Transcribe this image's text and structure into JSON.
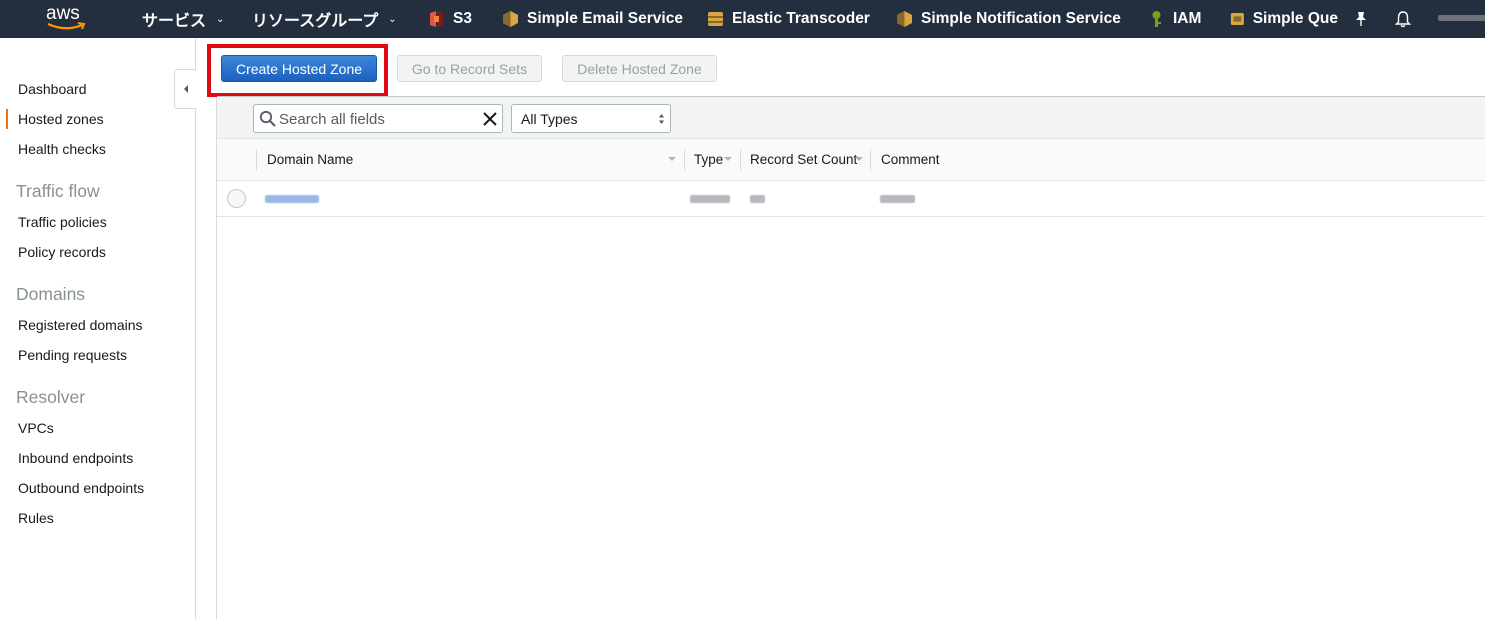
{
  "topnav": {
    "logo_text": "aws",
    "services_menu": "サービス",
    "resource_groups_menu": "リソースグループ",
    "services": [
      {
        "label": "S3",
        "icon": "s3-icon"
      },
      {
        "label": "Simple Email Service",
        "icon": "ses-icon"
      },
      {
        "label": "Elastic Transcoder",
        "icon": "transcoder-icon"
      },
      {
        "label": "Simple Notification Service",
        "icon": "sns-icon"
      },
      {
        "label": "IAM",
        "icon": "iam-icon"
      },
      {
        "label": "Simple Que",
        "icon": "sqs-icon"
      }
    ],
    "colors": {
      "bg": "#232f3e",
      "accent": "#ec7211"
    }
  },
  "sidebar": {
    "items": [
      {
        "label": "Dashboard"
      },
      {
        "label": "Hosted zones",
        "active": true
      }
    ],
    "health_checks": "Health checks",
    "sections": [
      {
        "heading": "Traffic flow",
        "items": [
          "Traffic policies",
          "Policy records"
        ]
      },
      {
        "heading": "Domains",
        "items": [
          "Registered domains",
          "Pending requests"
        ]
      },
      {
        "heading": "Resolver",
        "items": [
          "VPCs",
          "Inbound endpoints",
          "Outbound endpoints",
          "Rules"
        ]
      }
    ]
  },
  "toolbar": {
    "create_label": "Create Hosted Zone",
    "goto_label": "Go to Record Sets",
    "delete_label": "Delete Hosted Zone"
  },
  "filter": {
    "search_placeholder": "Search all fields",
    "type_select": "All Types"
  },
  "table": {
    "columns": [
      "Domain Name",
      "Type",
      "Record Set Count",
      "Comment"
    ]
  }
}
